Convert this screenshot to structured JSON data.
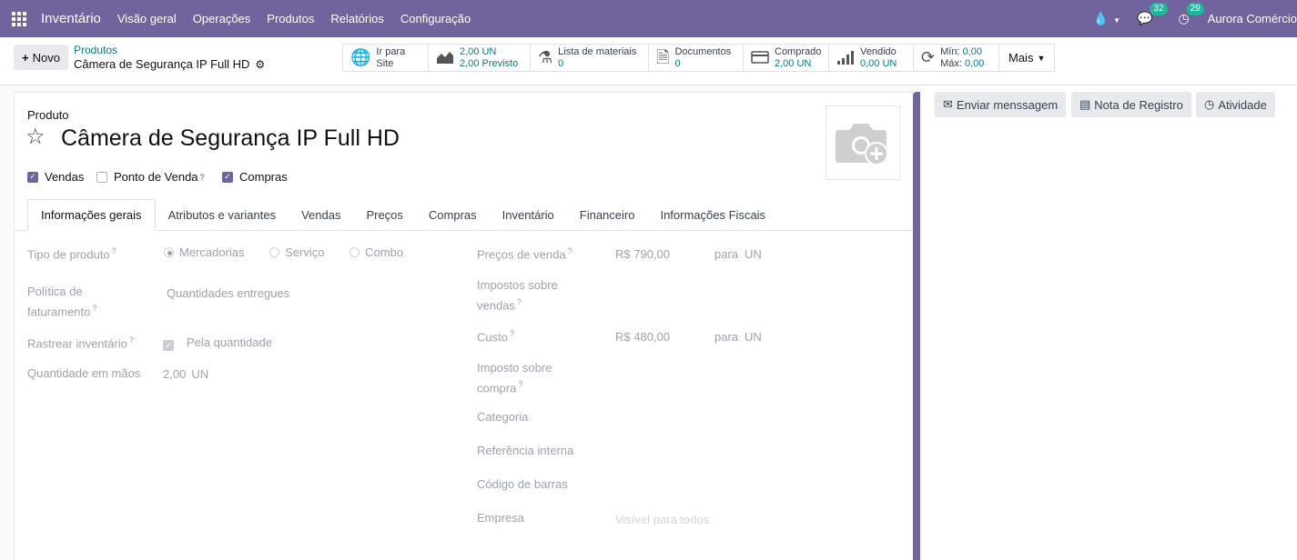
{
  "navbar": {
    "app_name": "Inventário",
    "menu": [
      "Visão geral",
      "Operações",
      "Produtos",
      "Relatórios",
      "Configuração"
    ],
    "messages_count": "32",
    "activities_count": "29",
    "company": "Aurora Comércio"
  },
  "control_panel": {
    "new_label": "Novo",
    "breadcrumb_parent": "Produtos",
    "breadcrumb_current": "Câmera de Segurança IP Full HD",
    "stat_buttons": {
      "website": {
        "line1": "Ir para",
        "line2": "Site"
      },
      "forecast": {
        "line1": "2,00 UN",
        "line2_value": "2,00",
        "line2_label": "Previsto"
      },
      "bom": {
        "label": "Lista de materiais",
        "value": "0"
      },
      "documents": {
        "label": "Documentos",
        "value": "0"
      },
      "purchased": {
        "label": "Comprado",
        "value": "2,00 UN"
      },
      "sold": {
        "label": "Vendido",
        "value": "0,00 UN"
      },
      "minmax": {
        "min_label": "Mín:",
        "min_value": "0,00",
        "max_label": "Máx:",
        "max_value": "0,00"
      }
    },
    "more_label": "Mais"
  },
  "form": {
    "product_label": "Produto",
    "product_name": "Câmera de Segurança IP Full HD",
    "options": {
      "sales": {
        "label": "Vendas",
        "checked": true
      },
      "pos": {
        "label": "Ponto de Venda",
        "checked": false
      },
      "purchase": {
        "label": "Compras",
        "checked": true
      }
    },
    "tabs": [
      "Informações gerais",
      "Atributos e variantes",
      "Vendas",
      "Preços",
      "Compras",
      "Inventário",
      "Financeiro",
      "Informações Fiscais"
    ],
    "left_fields": {
      "product_type": {
        "label": "Tipo de produto",
        "options": [
          "Mercadorias",
          "Serviço",
          "Combo"
        ],
        "selected": "Mercadorias"
      },
      "invoice_policy": {
        "label_line1": "Política de",
        "label_line2": "faturamento",
        "value": "Quantidades entregues"
      },
      "track_inventory": {
        "label": "Rastrear inventário",
        "value": "Pela quantidade"
      },
      "qty_on_hand": {
        "label": "Quantidade em mãos",
        "value": "2,00",
        "unit": "UN"
      }
    },
    "right_fields": {
      "sale_price": {
        "label": "Preços de venda",
        "value": "R$ 790,00",
        "per": "para",
        "unit": "UN"
      },
      "sale_taxes": {
        "label_line1": "Impostos sobre",
        "label_line2": "vendas"
      },
      "cost": {
        "label": "Custo",
        "value": "R$ 480,00",
        "per": "para",
        "unit": "UN"
      },
      "purchase_tax": {
        "label_line1": "Imposto sobre",
        "label_line2": "compra"
      },
      "category": {
        "label": "Categoria"
      },
      "internal_ref": {
        "label": "Referência interna"
      },
      "barcode": {
        "label": "Código de barras"
      },
      "company": {
        "label": "Empresa",
        "placeholder": "Visível para todos"
      }
    }
  },
  "chatter": {
    "send_message": "Enviar menssagem",
    "log_note": "Nota de Registro",
    "activity": "Atividade"
  }
}
